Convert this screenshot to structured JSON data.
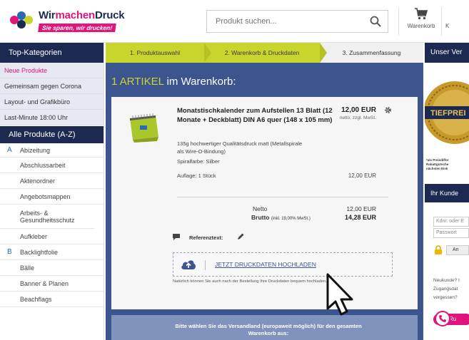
{
  "header": {
    "logo_name_part1": "Wir",
    "logo_name_part2": "machen",
    "logo_name_part3": "Druck",
    "logo_tagline": "Sie sparen, wir drucken!",
    "search_placeholder": "Produkt suchen...",
    "cart_label": "Warenkorb",
    "account_label": "K"
  },
  "sidebar": {
    "top_title": "Top-Kategorien",
    "top_categories": [
      "Neue Produkte",
      "Gemeinsam gegen Corona",
      "Layout- und Grafikbüro",
      "Last-Minute 18:00 Uhr"
    ],
    "all_title": "Alle Produkte (A-Z)",
    "letter_a": "A",
    "letter_b": "B",
    "items_a": [
      "Abizeitung",
      "Abschlussarbeit",
      "Aktenordner",
      "Angebotsmappen",
      "Arbeits- & Gesundheitsschutz",
      "Aufkleber"
    ],
    "items_b": [
      "Backlightfolie",
      "Bälle",
      "Banner & Planen",
      "Beachflags"
    ]
  },
  "steps": [
    "1. Produktauswahl",
    "2. Warenkorb & Druckdaten",
    "3. Zusammenfassung"
  ],
  "cart": {
    "count_label": "1 ARTIKEL",
    "title_rest": " im Warenkorb:",
    "product": {
      "title": "Monatstischkalender zum Aufstellen 13 Blatt (12 Monate + Deckblatt) DIN A6 quer (148 x 105 mm)",
      "price": "12,00 EUR",
      "netto_note": "netto, zzgl. MwSt.",
      "description": "135g hochwertiger Qualitätsdruck matt (Metallspirale als Wire-O-Bindung)",
      "spiral": "Spiralfarbe: Silber",
      "quantity": "Auflage: 1 Stück",
      "quantity_price": "12,00 EUR"
    },
    "netto_label": "Netto",
    "netto_value": "12,00 EUR",
    "brutto_label": "Brutto",
    "brutto_note": "(inkl. 19,00% MwSt.)",
    "brutto_value": "14,28 EUR",
    "reference_label": "Referenztext:",
    "upload_link": "JETZT DRUCKDATEN HOCHLADEN",
    "upload_note": "Natürlich können Sie auch nach der Bestellung Ihre Druckdaten bequem hochladen.",
    "shipping_text": "Bitte wählen Sie das Versandland (europaweit möglich) für den gesamten Warenkorb aus:"
  },
  "right": {
    "title": "Unser Ver",
    "badge_text": "TIEFPREI",
    "fine_print": [
      "*als Preisdiffer",
      "Rabattgutsche",
      "nächsten Eink"
    ],
    "customer_title": "Ihr Kunde",
    "email_placeholder": "Kdnr. oder E",
    "password_placeholder": "Passwort",
    "login_label": "An",
    "new_customer": "Neukunde? I",
    "access_data": "Zugangsdat",
    "forgot": "vergessen?",
    "call_label": "Ru"
  },
  "colors": {
    "navy": "#1c2a52",
    "panel_blue": "#3c558f",
    "lime": "#c7d52c",
    "magenta": "#e0147a"
  }
}
